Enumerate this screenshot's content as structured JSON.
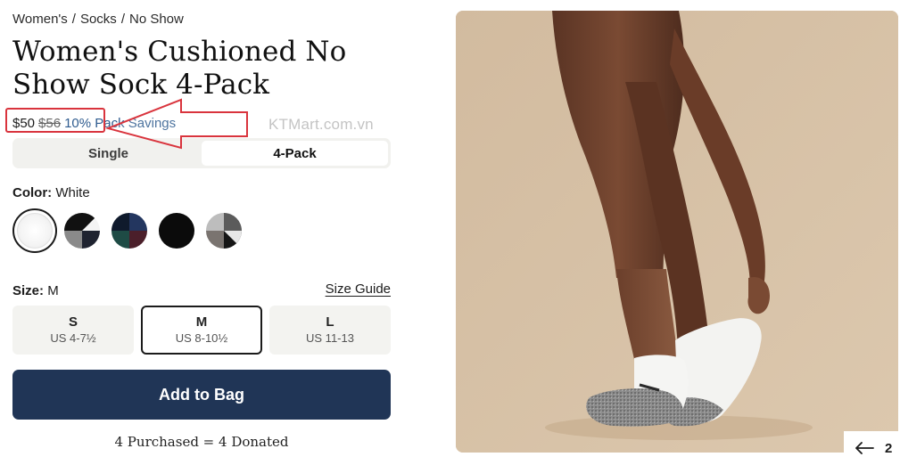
{
  "breadcrumb": [
    "Women's",
    "Socks",
    "No Show"
  ],
  "product": {
    "title": "Women's Cushioned No Show Sock 4-Pack",
    "price_current": "$50",
    "price_old": "$56",
    "savings": "10% Pack Savings"
  },
  "watermark": "KTMart.com.vn",
  "pack_options": [
    {
      "label": "Single",
      "active": false
    },
    {
      "label": "4-Pack",
      "active": true
    }
  ],
  "color": {
    "label": "Color:",
    "selected": "White",
    "swatch_names": [
      "White",
      "Black/White/Grey Mix",
      "Navy/Green/Maroon Mix",
      "Black",
      "Grey Mix"
    ]
  },
  "size": {
    "label": "Size:",
    "selected": "M",
    "guide_label": "Size Guide",
    "options": [
      {
        "code": "S",
        "range": "US 4-7½"
      },
      {
        "code": "M",
        "range": "US 8-10½"
      },
      {
        "code": "L",
        "range": "US 11-13"
      }
    ]
  },
  "cta": {
    "add_to_bag": "Add to Bag",
    "donation_note": "4 Purchased = 4 Donated"
  },
  "carousel": {
    "slide": "2",
    "arrow_icon": "arrow-left-icon"
  },
  "colors": {
    "button": "#203556",
    "savings_text": "#2f5c8f",
    "annotation": "#d9343d",
    "photo_bg": "#d6c0a5"
  }
}
